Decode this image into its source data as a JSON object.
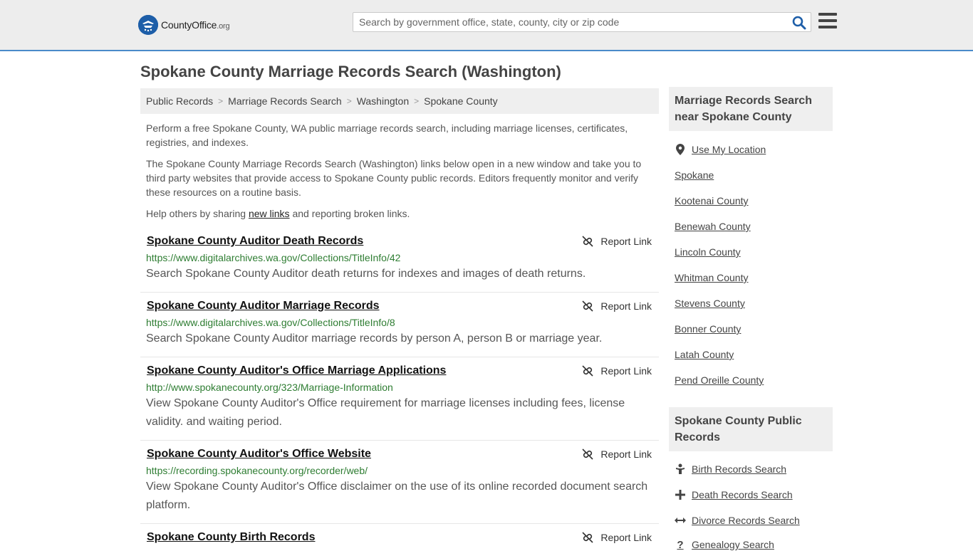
{
  "header": {
    "logo_main": "CountyOffice",
    "logo_suffix": ".org",
    "search_placeholder": "Search by government office, state, county, city or zip code"
  },
  "page_title": "Spokane County Marriage Records Search (Washington)",
  "breadcrumb": [
    "Public Records",
    "Marriage Records Search",
    "Washington",
    "Spokane County"
  ],
  "intro": {
    "p1": "Perform a free Spokane County, WA public marriage records search, including marriage licenses, certificates, registries, and indexes.",
    "p2": "The Spokane County Marriage Records Search (Washington) links below open in a new window and take you to third party websites that provide access to Spokane County public records. Editors frequently monitor and verify these resources on a routine basis.",
    "p3_before": "Help others by sharing ",
    "p3_link": "new links",
    "p3_after": " and reporting broken links."
  },
  "report_label": "Report Link",
  "results": [
    {
      "title": "Spokane County Auditor Death Records",
      "url": "https://www.digitalarchives.wa.gov/Collections/TitleInfo/42",
      "desc": "Search Spokane County Auditor death returns for indexes and images of death returns."
    },
    {
      "title": "Spokane County Auditor Marriage Records",
      "url": "https://www.digitalarchives.wa.gov/Collections/TitleInfo/8",
      "desc": "Search Spokane County Auditor marriage records by person A, person B or marriage year."
    },
    {
      "title": "Spokane County Auditor's Office Marriage Applications",
      "url": "http://www.spokanecounty.org/323/Marriage-Information",
      "desc": "View Spokane County Auditor's Office requirement for marriage licenses including fees, license validity. and waiting period."
    },
    {
      "title": "Spokane County Auditor's Office Website",
      "url": "https://recording.spokanecounty.org/recorder/web/",
      "desc": "View Spokane County Auditor's Office disclaimer on the use of its online recorded document search platform."
    },
    {
      "title": "Spokane County Birth Records",
      "url": "",
      "desc": ""
    }
  ],
  "sidebar": {
    "nearby_heading": "Marriage Records Search near Spokane County",
    "use_location": "Use My Location",
    "nearby": [
      "Spokane",
      "Kootenai County",
      "Benewah County",
      "Lincoln County",
      "Whitman County",
      "Stevens County",
      "Bonner County",
      "Latah County",
      "Pend Oreille County"
    ],
    "public_heading": "Spokane County Public Records",
    "public_links": [
      {
        "label": "Birth Records Search",
        "icon": "baby-icon"
      },
      {
        "label": "Death Records Search",
        "icon": "cross-icon"
      },
      {
        "label": "Divorce Records Search",
        "icon": "arrows-horizontal-icon"
      },
      {
        "label": "Genealogy Search",
        "icon": "question-icon"
      }
    ]
  },
  "colors": {
    "accent_border": "#4a8ac9",
    "url_green": "#2e7d32",
    "logo_blue": "#1d5ea8"
  }
}
